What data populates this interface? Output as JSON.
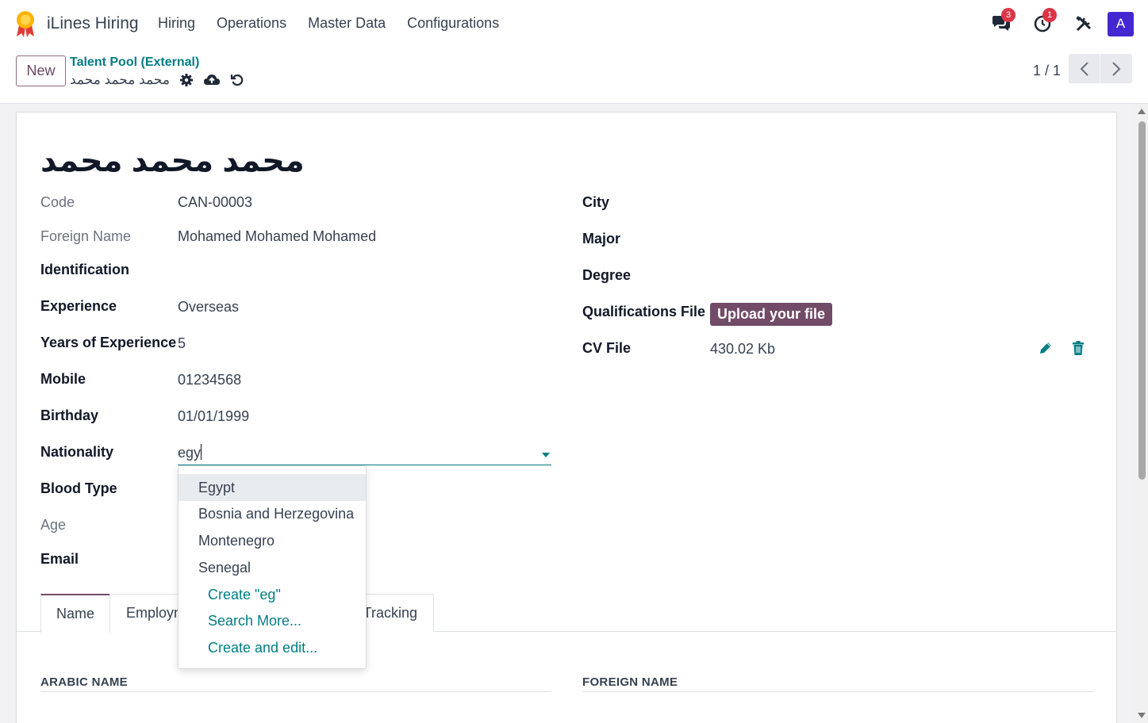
{
  "navbar": {
    "app_name": "iLines Hiring",
    "menu": [
      "Hiring",
      "Operations",
      "Master Data",
      "Configurations"
    ],
    "messages_badge": "3",
    "activities_badge": "1",
    "avatar_initial": "A"
  },
  "control_panel": {
    "new_label": "New",
    "breadcrumb_parent": "Talent Pool (External)",
    "breadcrumb_current": "محمد محمد محمد",
    "pager": "1 / 1"
  },
  "record": {
    "title": "محمد محمد محمد"
  },
  "left_fields": [
    {
      "label": "Code",
      "value": "CAN-00003",
      "muted": true
    },
    {
      "label": "Foreign Name",
      "value": "Mohamed Mohamed Mohamed",
      "muted": true
    },
    {
      "label": "Identification",
      "value": "",
      "muted": false
    },
    {
      "label": "Experience",
      "value": "Overseas",
      "muted": false
    },
    {
      "label": "Years of Experience",
      "value": "5",
      "muted": false
    },
    {
      "label": "Mobile",
      "value": "01234568",
      "muted": false
    },
    {
      "label": "Birthday",
      "value": "01/01/1999",
      "muted": false
    },
    {
      "label": "Nationality",
      "value": "",
      "muted": false
    },
    {
      "label": "Blood Type",
      "value": "",
      "muted": false
    },
    {
      "label": "Age",
      "value": "",
      "muted": true
    },
    {
      "label": "Email",
      "value": "",
      "muted": false
    }
  ],
  "nationality_input": "egy",
  "right_fields": {
    "city_label": "City",
    "major_label": "Major",
    "degree_label": "Degree",
    "qualifications_label": "Qualifications File",
    "upload_label": "Upload your file",
    "cv_label": "CV File",
    "cv_value": "430.02 Kb"
  },
  "dropdown": {
    "options": [
      "Egypt",
      "Bosnia and Herzegovina",
      "Montenegro",
      "Senegal"
    ],
    "actions": [
      "Create \"eg\"",
      "Search More...",
      "Create and edit..."
    ]
  },
  "tabs": {
    "name": "Name",
    "employment": "Employment",
    "tracking": "Tracking"
  },
  "sections": {
    "arabic_name": "ARABIC NAME",
    "foreign_name": "FOREIGN NAME"
  },
  "colors": {
    "brand": "#714b67",
    "accent": "#017e84",
    "badge": "#dc3545",
    "avatar": "#4527d1"
  }
}
